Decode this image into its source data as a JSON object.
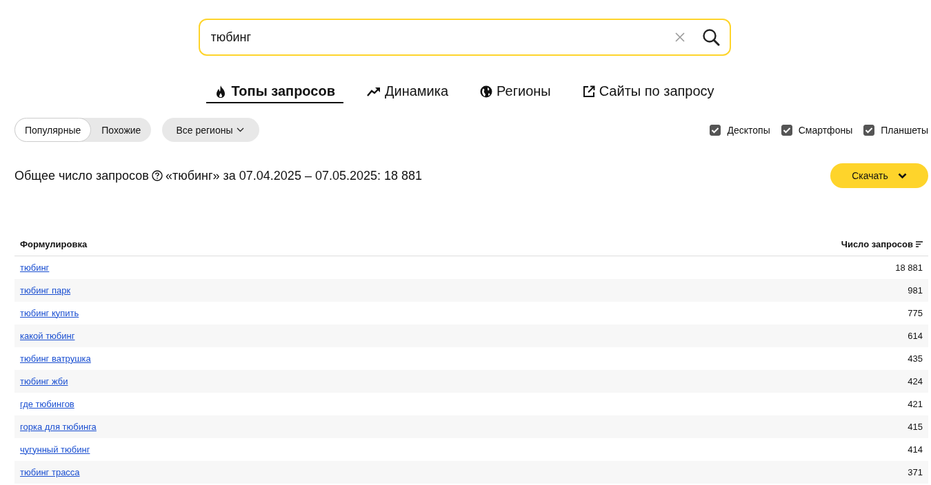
{
  "search": {
    "value": "тюбинг"
  },
  "tabs": [
    {
      "label": "Топы запросов",
      "kind": "fire",
      "selected": true
    },
    {
      "label": "Динамика",
      "kind": "trend",
      "selected": false
    },
    {
      "label": "Регионы",
      "kind": "globe",
      "selected": false
    },
    {
      "label": "Сайты по запросу",
      "kind": "external",
      "selected": false
    }
  ],
  "modes": [
    {
      "label": "Популярные",
      "selected": true
    },
    {
      "label": "Похожие",
      "selected": false
    }
  ],
  "region_dropdown": {
    "label": "Все регионы"
  },
  "devices": [
    {
      "label": "Десктопы",
      "checked": true
    },
    {
      "label": "Смартфоны",
      "checked": true
    },
    {
      "label": "Планшеты",
      "checked": true
    }
  ],
  "summary": {
    "label": "Общее число запросов",
    "text": "«тюбинг» за 07.04.2025 – 07.05.2025: 18 881"
  },
  "download_button": {
    "label": "Скачать"
  },
  "table": {
    "columns": [
      "Формулировка",
      "Число запросов"
    ],
    "rows": [
      [
        "тюбинг",
        "18 881"
      ],
      [
        "тюбинг парк",
        "981"
      ],
      [
        "тюбинг купить",
        "775"
      ],
      [
        "какой тюбинг",
        "614"
      ],
      [
        "тюбинг ватрушка",
        "435"
      ],
      [
        "тюбинг жби",
        "424"
      ],
      [
        "где тюбингов",
        "421"
      ],
      [
        "горка для тюбинга",
        "415"
      ],
      [
        "чугунный тюбинг",
        "414"
      ],
      [
        "тюбинг трасса",
        "371"
      ]
    ]
  }
}
